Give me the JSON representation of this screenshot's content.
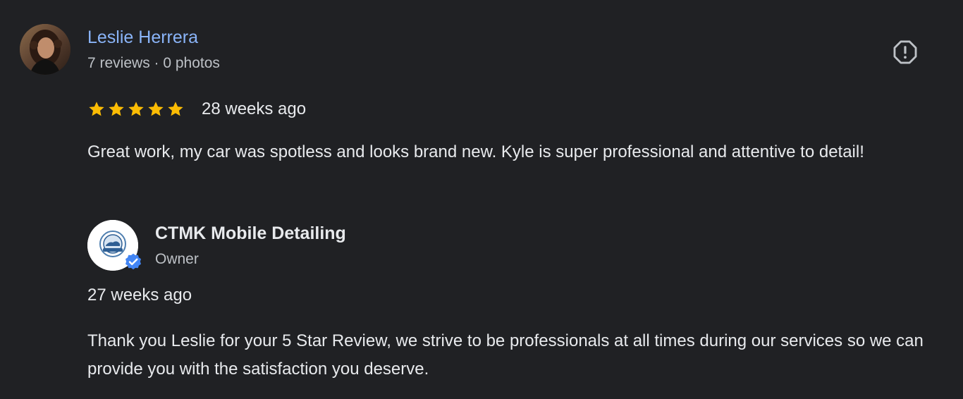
{
  "review": {
    "reviewer": {
      "name": "Leslie Herrera",
      "meta": "7 reviews · 0 photos",
      "avatar_icon": "user-photo"
    },
    "rating": 5,
    "rating_max": 5,
    "date": "28 weeks ago",
    "text": "Great work, my car was spotless and looks brand new. Kyle is super professional and attentive to detail!",
    "report_icon": "report-flag-icon"
  },
  "owner_reply": {
    "name": "CTMK Mobile Detailing",
    "role": "Owner",
    "date": "27 weeks ago",
    "text": "Thank you Leslie for your 5 Star Review, we strive to be professionals at all times during our services so we can provide you with the satisfaction you deserve.",
    "verified": true
  },
  "colors": {
    "background": "#202124",
    "link": "#8ab4f8",
    "star": "#fbbc04",
    "secondary_text": "#bdc1c6",
    "primary_text": "#e8eaed",
    "verified_badge": "#4285f4"
  }
}
